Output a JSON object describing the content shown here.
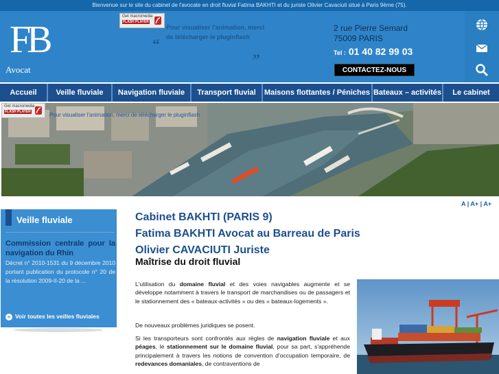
{
  "topbar": {
    "text": "Bienvenue sur le site du cabinet de l'avocate en droit fluvial Fatima BAKHTI et du juriste Olivier Cavaciuti situé à Paris 9ème (75)."
  },
  "logo": {
    "monogram": "FB",
    "subtitle": "Avocat"
  },
  "flash": {
    "badge_line1": "Get macromedia",
    "badge_line2": "FLASH PLAYER",
    "header_text": "Pour visualiser l'animation, merci de télécharger le pluginflash",
    "banner_text": "Pour visualiser l'animation, merci de télécharger le pluginflash"
  },
  "contact": {
    "address_line1": "2 rue Pierre Semard",
    "address_line2": "75009 PARIS",
    "tel_label": "Tel :",
    "tel_number": "01 40 82 99 03",
    "button": "CONTACTEZ-NOUS"
  },
  "icons": [
    "globe-icon",
    "mail-icon",
    "search-icon"
  ],
  "nav": {
    "items": [
      "Accueil",
      "Veille fluviale",
      "Navigation fluviale",
      "Transport fluvial",
      "Maisons flottantes / Péniches",
      "Bateaux – activités",
      "Le cabinet"
    ]
  },
  "font_controls": {
    "a": "A",
    "a_plus": "A+",
    "a_plus_plus": "A+",
    "sep": "|"
  },
  "sidebar": {
    "title": "Veille fluviale",
    "link": "Commission centrale pour la navigation du Rhin",
    "description": "Décret n° 2010-1531 du 9 décembre 2010 portant publication du protocole n° 20 de la résolution 2009-II-20 de la ...",
    "footer_bullet": "»",
    "footer": "Voir toutes les veilles fluviales"
  },
  "main": {
    "heading1": "Cabinet BAKHTI (PARIS 9)",
    "heading2": "Fatima BAKHTI Avocat au Barreau de Paris",
    "heading3": "Olivier CAVACIUTI Juriste",
    "subheading": "Maîtrise du droit fluvial",
    "p1_a": "L'utilisation du ",
    "p1_b": "domaine fluvial",
    "p1_c": " et des voies navigables augmente et se développe notamment à travers le transport de marchandises ou de passagers et le stationnement des « bateaux-activités » ou des « bateaux-logements ».",
    "p2": "De nouveaux problèmes juridiques se posent.",
    "p3_a": "Si les transporteurs sont confrontés aux règles de ",
    "p3_b": "navigation fluviale",
    "p3_c": " et aux ",
    "p3_d": "péages",
    "p3_e": ", le ",
    "p3_f": "stationnement sur le domaine fluvial",
    "p3_g": ", pour sa part, s'appréhende principalement à travers les notions de convention d'occupation temporaire, de ",
    "p3_h": "redevances domaniales",
    "p3_i": ", de contraventions de"
  }
}
